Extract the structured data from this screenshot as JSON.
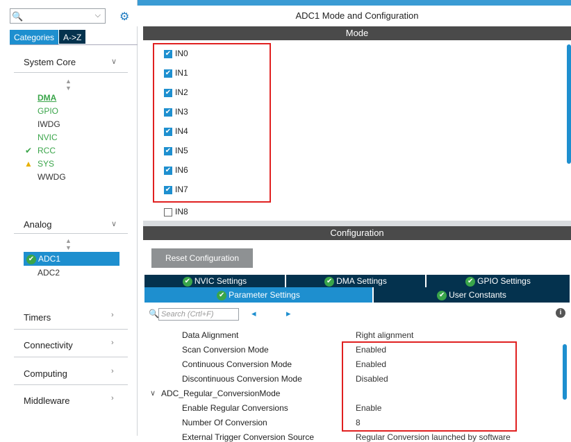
{
  "left": {
    "search_placeholder": "",
    "tabs": [
      "Categories",
      "A->Z"
    ],
    "groups": {
      "system_core": "System Core",
      "analog": "Analog",
      "timers": "Timers",
      "connectivity": "Connectivity",
      "computing": "Computing",
      "middleware": "Middleware"
    },
    "system_core_items": [
      "DMA",
      "GPIO",
      "IWDG",
      "NVIC",
      "RCC",
      "SYS",
      "WWDG"
    ],
    "analog_items": [
      "ADC1",
      "ADC2"
    ]
  },
  "main": {
    "title": "ADC1 Mode and Configuration",
    "mode_header": "Mode",
    "channels": [
      "IN0",
      "IN1",
      "IN2",
      "IN3",
      "IN4",
      "IN5",
      "IN6",
      "IN7",
      "IN8"
    ],
    "config_header": "Configuration",
    "reset_label": "Reset Configuration",
    "tabs_row1": [
      "NVIC Settings",
      "DMA Settings",
      "GPIO Settings"
    ],
    "tabs_row2": [
      "Parameter Settings",
      "User Constants"
    ],
    "search_placeholder": "Search (Crtl+F)",
    "params": [
      {
        "label": "Data Alignment",
        "value": "Right alignment"
      },
      {
        "label": "Scan Conversion Mode",
        "value": "Enabled"
      },
      {
        "label": "Continuous Conversion Mode",
        "value": "Enabled"
      },
      {
        "label": "Discontinuous Conversion Mode",
        "value": "Disabled"
      },
      {
        "label": "ADC_Regular_ConversionMode",
        "value": ""
      },
      {
        "label": "Enable Regular Conversions",
        "value": "Enable"
      },
      {
        "label": "Number Of Conversion",
        "value": "8"
      },
      {
        "label": "External Trigger Conversion Source",
        "value": "Regular Conversion launched by software"
      }
    ]
  },
  "colors": {
    "accent": "#1e8fcf",
    "dark_header": "#4a4a4a",
    "green": "#3aa54a",
    "highlight": "#e02020"
  }
}
